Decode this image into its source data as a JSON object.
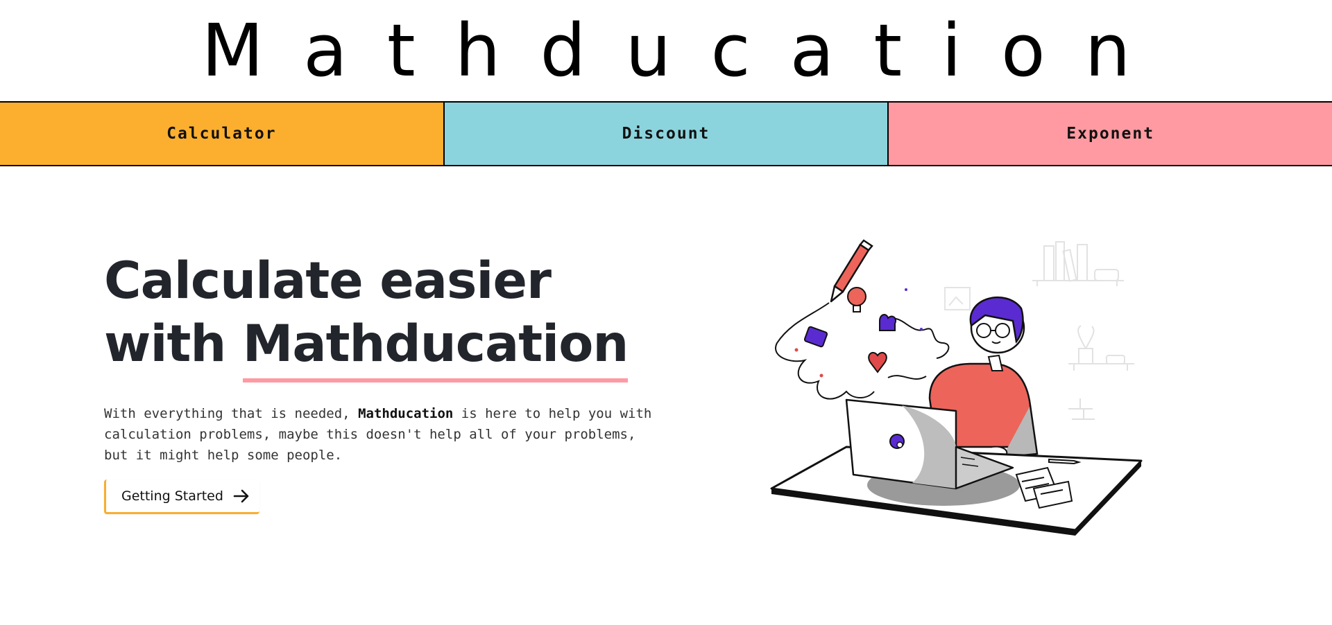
{
  "brand": {
    "title": "Mathducation"
  },
  "nav": {
    "items": [
      {
        "label": "Calculator",
        "color": "#fcaf2f"
      },
      {
        "label": "Discount",
        "color": "#8cd4dd"
      },
      {
        "label": "Exponent",
        "color": "#ff9aa2"
      }
    ]
  },
  "hero": {
    "title_line1": "Calculate easier",
    "title_line2_prefix": "with",
    "title_line2_highlight": "Mathducation",
    "description_before": "With everything that is needed,",
    "description_bold": "Mathducation",
    "description_after": "is here to help you with calculation problems, maybe this doesn't help all of your problems, but it might help some people.",
    "cta_label": "Getting Started",
    "cta_icon": "arrow-right-icon",
    "underline_color": "#ff9aa2",
    "cta_accent_color": "#f8ae2e"
  },
  "illustration": {
    "icon": "person-at-laptop-illustration",
    "accent_colors": [
      "#5a2bd1",
      "#ed645a",
      "#e04a4a"
    ]
  }
}
